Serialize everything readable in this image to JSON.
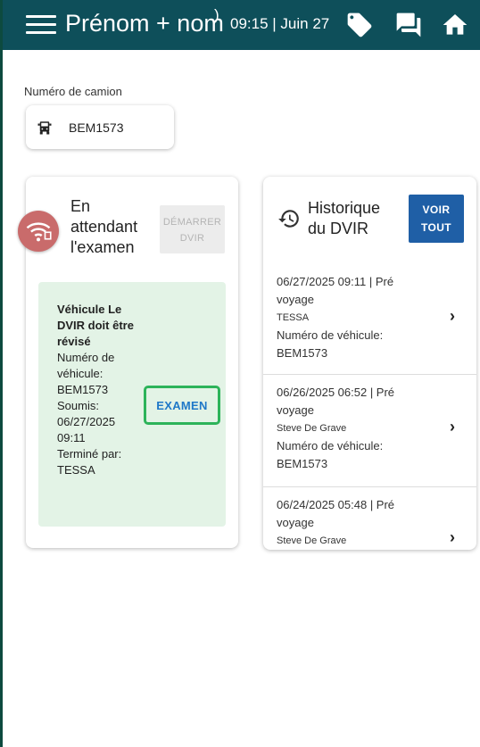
{
  "header": {
    "title": "Prénom + nom",
    "time": "09:15 | Juin 27"
  },
  "truck": {
    "label": "Numéro de camion",
    "number": "BEM1573"
  },
  "pending_card": {
    "title_line1": "En",
    "title_line2": "attendant",
    "title_line3": "l'examen",
    "start_line1": "DÉMARRER",
    "start_line2": "DVIR",
    "notice_line1": "Véhicule Le",
    "notice_line2": "DVIR doit être",
    "notice_line3": "révisé",
    "vehicle_label_1": "Numéro de",
    "vehicle_label_2": "véhicule:",
    "vehicle_value": "BEM1573",
    "submitted_label": "Soumis:",
    "submitted_date": "06/27/2025",
    "submitted_time": "09:11",
    "completed_label": "Terminé par:",
    "completed_by": "TESSA",
    "exam_button": "EXAMEN"
  },
  "history_card": {
    "title_line1": "Historique",
    "title_line2": "du DVIR",
    "see_all_line1": "VOIR",
    "see_all_line2": "TOUT",
    "items": [
      {
        "header": "06/27/2025 09:11 | Pré",
        "trip": "voyage",
        "driver": "TESSA",
        "vehicle_label": "Numéro de véhicule:",
        "vehicle": "BEM1573"
      },
      {
        "header": "06/26/2025 06:52 | Pré",
        "trip": "voyage",
        "driver": "Steve De Grave",
        "vehicle_label": "Numéro de véhicule:",
        "vehicle": "BEM1573"
      },
      {
        "header": "06/24/2025 05:48 | Pré",
        "trip": "voyage",
        "driver": "Steve De Grave"
      }
    ]
  },
  "icons": {
    "menu": "menu-icon",
    "tag": "tag-icon",
    "chat": "chat-icon",
    "home": "home-icon",
    "truck": "truck-icon",
    "history": "history-icon",
    "chevron": "chevron-right-icon",
    "connectivity": "wifi-off-icon"
  },
  "colors": {
    "app_bar": "#0e4f5a",
    "primary_button": "#1f5fa6",
    "pending_panel": "#e3f3e6",
    "exam_outline": "#2db35a",
    "exam_text": "#1f78c8"
  }
}
